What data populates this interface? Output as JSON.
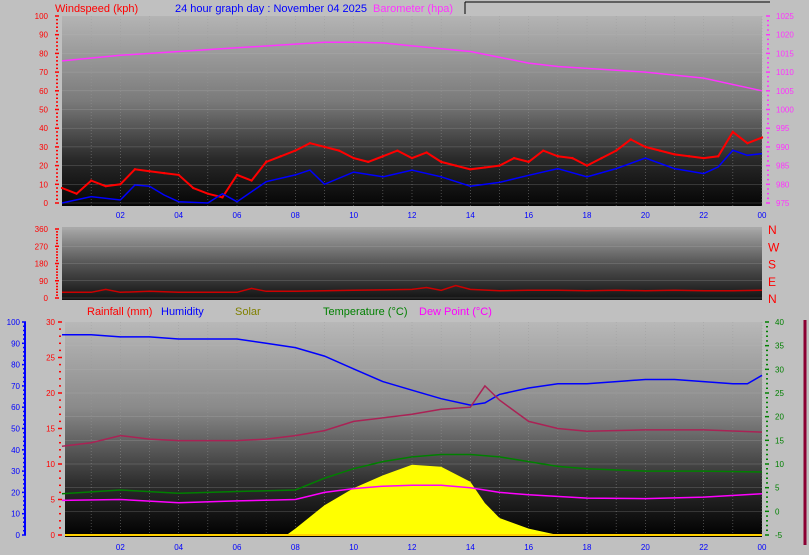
{
  "header": {
    "title": "24 hour graph day : November 04 2025",
    "left_label": "Windspeed (kph)",
    "right_label": "Barometer (hpa)"
  },
  "colors": {
    "windspeed": "#ff0000",
    "wind_avg": "#0000ff",
    "barometer": "#ff33ff",
    "direction": "#cc0000",
    "rainfall": "#ff0000",
    "humidity": "#0000ff",
    "solar": "#ffff00",
    "solar_label": "#808000",
    "temperature": "#008000",
    "dewpoint": "#ff00ff",
    "unlabeled_series": "#aa2255",
    "time_axis": "#0000ff"
  },
  "chart_data": [
    {
      "type": "line",
      "panel": "wind-barometer",
      "title": "24 hour graph day : November 04 2025",
      "x_tick_labels": [
        "02",
        "04",
        "06",
        "08",
        "10",
        "12",
        "14",
        "16",
        "18",
        "20",
        "22",
        "00"
      ],
      "xlim_hours": [
        0,
        24
      ],
      "left_axis": {
        "label": "Windspeed (kph)",
        "ylim": [
          0,
          100
        ],
        "ticks": [
          "0",
          "10",
          "20",
          "30",
          "40",
          "50",
          "60",
          "70",
          "80",
          "90",
          "100"
        ]
      },
      "right_axis": {
        "label": "Barometer (hpa)",
        "ylim": [
          975,
          1025
        ],
        "ticks": [
          "975",
          "980",
          "985",
          "990",
          "995",
          "1000",
          "1005",
          "1010",
          "1015",
          "1020",
          "1025"
        ]
      },
      "grid": true,
      "series": [
        {
          "name": "Windspeed (kph)",
          "axis": "left",
          "color": "#ff0000",
          "x": [
            0,
            0.5,
            1,
            1.5,
            2,
            2.5,
            3,
            3.5,
            4,
            4.5,
            5,
            5.5,
            6,
            6.5,
            7,
            7.5,
            8,
            8.5,
            9,
            9.5,
            10,
            10.5,
            11,
            11.5,
            12,
            12.5,
            13,
            13.5,
            14,
            14.5,
            15,
            15.5,
            16,
            16.5,
            17,
            17.5,
            18,
            18.5,
            19,
            19.5,
            20,
            20.5,
            21,
            21.5,
            22,
            22.5,
            23,
            23.5,
            24
          ],
          "y": [
            8,
            5,
            12,
            9,
            10,
            18,
            17,
            16,
            15,
            8,
            5,
            3,
            15,
            12,
            22,
            25,
            28,
            32,
            30,
            28,
            24,
            22,
            25,
            28,
            24,
            27,
            22,
            20,
            18,
            19,
            20,
            24,
            22,
            28,
            25,
            24,
            20,
            24,
            28,
            34,
            30,
            28,
            26,
            25,
            24,
            25,
            38,
            32,
            35
          ]
        },
        {
          "axis": "left",
          "color": "#0000ff",
          "x": [
            0,
            1,
            2,
            2.5,
            3,
            3.5,
            4,
            5,
            5.5,
            6,
            7,
            8,
            8.5,
            9,
            10,
            11,
            12,
            13,
            14,
            15,
            16,
            17,
            18,
            19,
            20,
            21,
            22,
            22.5,
            23,
            23.5,
            24
          ],
          "y": [
            0,
            3.4,
            1.6,
            9.6,
            9,
            4.3,
            0.7,
            0,
            5,
            0.7,
            11.4,
            15,
            17.6,
            10,
            16.5,
            14,
            17.6,
            14,
            9,
            11,
            14.8,
            18.4,
            14,
            18.4,
            24,
            18.4,
            15.7,
            19.3,
            28.2,
            25.5,
            26.4
          ]
        },
        {
          "name": "Barometer (hpa)",
          "axis": "right",
          "color": "#ff33ff",
          "x": [
            0,
            2,
            4,
            6,
            8,
            9,
            10,
            11,
            12,
            14,
            16,
            17,
            18,
            20,
            22,
            24
          ],
          "y": [
            1013,
            1014.5,
            1015.5,
            1016.5,
            1017.5,
            1018,
            1018,
            1017.8,
            1017,
            1015.5,
            1012.4,
            1011.5,
            1011,
            1010,
            1008.4,
            1005
          ]
        }
      ]
    },
    {
      "type": "line",
      "panel": "wind-direction",
      "xlim_hours": [
        0,
        24
      ],
      "left_axis": {
        "ylim": [
          0,
          360
        ],
        "ticks": [
          "0",
          "90",
          "180",
          "270",
          "360"
        ]
      },
      "right_axis": {
        "ticks": [
          "N",
          "E",
          "S",
          "W",
          "N"
        ]
      },
      "series": [
        {
          "color": "#cc0000",
          "x": [
            0,
            1,
            1.5,
            2,
            3,
            4,
            6,
            6.5,
            7,
            8,
            9,
            10,
            11,
            12,
            12.5,
            13,
            13.5,
            14,
            15,
            16,
            17,
            18,
            19,
            20,
            21,
            22,
            23,
            24
          ],
          "y": [
            30,
            30,
            45,
            30,
            35,
            30,
            30,
            50,
            35,
            35,
            38,
            40,
            42,
            45,
            55,
            40,
            65,
            45,
            38,
            40,
            40,
            38,
            40,
            38,
            40,
            38,
            38,
            40
          ]
        }
      ]
    },
    {
      "type": "line",
      "panel": "rain-humidity-solar-temperature",
      "legend": [
        "Rainfall (mm)",
        "Humidity",
        "Solar",
        "Temperature (°C)",
        "Dew Point (°C)"
      ],
      "legend_position": "top",
      "x_tick_labels": [
        "02",
        "04",
        "06",
        "08",
        "10",
        "12",
        "14",
        "16",
        "18",
        "20",
        "22",
        "00"
      ],
      "xlim_hours": [
        0,
        24
      ],
      "humidity_axis": {
        "ylim": [
          0,
          100
        ],
        "ticks": [
          "0",
          "10",
          "20",
          "30",
          "40",
          "50",
          "60",
          "70",
          "80",
          "90",
          "100"
        ]
      },
      "rainfall_axis": {
        "ylim": [
          0,
          30
        ],
        "ticks": [
          "0",
          "5",
          "10",
          "15",
          "20",
          "25",
          "30"
        ]
      },
      "temperature_axis": {
        "ylim": [
          -5,
          40
        ],
        "ticks": [
          "-5",
          "0",
          "5",
          "10",
          "15",
          "20",
          "25",
          "30",
          "35",
          "40"
        ]
      },
      "grid": true,
      "series": [
        {
          "name": "Humidity",
          "axis": "humidity",
          "color": "#0000ff",
          "x": [
            0,
            1,
            2,
            3,
            4,
            5,
            6,
            7,
            8,
            9,
            10,
            11,
            12,
            13,
            14,
            14.5,
            15,
            16,
            17,
            18,
            19,
            20,
            21,
            22,
            23,
            23.5,
            24
          ],
          "y": [
            94,
            94,
            93,
            93,
            92,
            92,
            92,
            90,
            88,
            84,
            78,
            72,
            68,
            64,
            61,
            62,
            66,
            69,
            71,
            71,
            72,
            73,
            73,
            72,
            71,
            71,
            75
          ]
        },
        {
          "axis": "rainfall",
          "color": "#aa2255",
          "x": [
            0,
            1,
            2,
            3,
            4,
            6,
            7,
            8,
            9,
            10,
            11,
            12,
            13,
            14,
            14.5,
            15,
            16,
            17,
            18,
            20,
            22,
            24
          ],
          "y": [
            12.5,
            13,
            14,
            13.5,
            13.3,
            13.3,
            13.5,
            14,
            14.7,
            16,
            16.5,
            17,
            17.7,
            18,
            21,
            19,
            16,
            15,
            14.6,
            14.8,
            14.8,
            14.5
          ]
        },
        {
          "name": "Temperature (°C)",
          "axis": "temperature",
          "color": "#008000",
          "x": [
            0,
            2,
            4,
            6,
            8,
            9,
            10,
            11,
            12,
            13,
            14,
            15,
            16,
            17,
            18,
            20,
            22,
            24
          ],
          "y": [
            3.7,
            4.5,
            3.8,
            4.2,
            4.5,
            7,
            9,
            10.5,
            11.5,
            12,
            12,
            11.5,
            10.5,
            9.5,
            9,
            8.5,
            8.5,
            8.3
          ]
        },
        {
          "name": "Dew Point (°C)",
          "axis": "temperature",
          "color": "#ff00ff",
          "x": [
            0,
            2,
            4,
            6,
            8,
            9,
            10,
            11,
            12,
            13,
            14,
            15,
            16,
            18,
            20,
            22,
            24
          ],
          "y": [
            2.3,
            2.5,
            1.8,
            2.2,
            2.5,
            4,
            4.8,
            5.3,
            5.5,
            5.5,
            5,
            4,
            3.5,
            2.8,
            2.7,
            3,
            3.7
          ]
        },
        {
          "name": "Solar",
          "type": "area",
          "axis": "humidity",
          "color": "#ffff00",
          "x": [
            0,
            7.7,
            8,
            9,
            10,
            11,
            12,
            13,
            14,
            14.5,
            15,
            16,
            17,
            24
          ],
          "y": [
            0,
            0,
            3,
            14,
            22,
            28,
            33,
            32,
            25,
            15,
            8,
            3,
            0,
            0
          ]
        }
      ]
    }
  ]
}
